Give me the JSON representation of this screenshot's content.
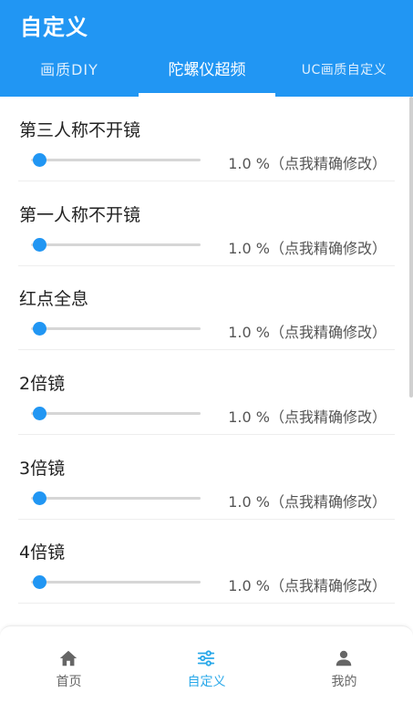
{
  "header": {
    "title": "自定义"
  },
  "tabs": [
    {
      "label": "画质DIY"
    },
    {
      "label": "陀螺仪超频"
    },
    {
      "label": "UC画质自定义"
    }
  ],
  "rows": [
    {
      "label": "第三人称不开镜",
      "value": 1.0,
      "value_text": "1.0 %（点我精确修改）"
    },
    {
      "label": "第一人称不开镜",
      "value": 1.0,
      "value_text": "1.0 %（点我精确修改）"
    },
    {
      "label": "红点全息",
      "value": 1.0,
      "value_text": "1.0 %（点我精确修改）"
    },
    {
      "label": "2倍镜",
      "value": 1.0,
      "value_text": "1.0 %（点我精确修改）"
    },
    {
      "label": "3倍镜",
      "value": 1.0,
      "value_text": "1.0 %（点我精确修改）"
    },
    {
      "label": "4倍镜",
      "value": 1.0,
      "value_text": "1.0 %（点我精确修改）"
    }
  ],
  "nav": [
    {
      "label": "首页",
      "icon": "home-icon"
    },
    {
      "label": "自定义",
      "icon": "sliders-icon"
    },
    {
      "label": "我的",
      "icon": "user-icon"
    }
  ],
  "colors": {
    "accent": "#2196f3",
    "nav_active": "#29a8e9",
    "track": "#d6d6d6"
  }
}
